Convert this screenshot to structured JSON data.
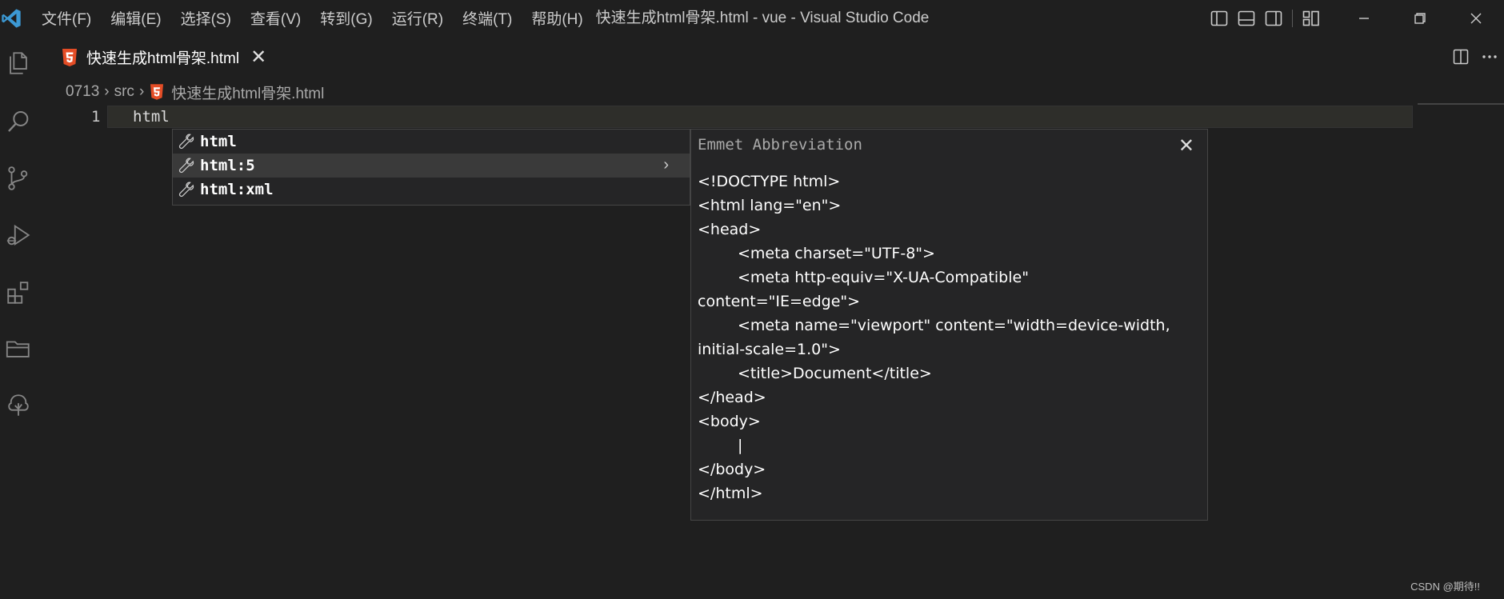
{
  "titlebar": {
    "menu": [
      "文件(F)",
      "编辑(E)",
      "选择(S)",
      "查看(V)",
      "转到(G)",
      "运行(R)",
      "终端(T)",
      "帮助(H)"
    ],
    "title": "快速生成html骨架.html - vue - Visual Studio Code"
  },
  "tab": {
    "label": "快速生成html骨架.html",
    "close": "✕"
  },
  "breadcrumb": {
    "items": [
      "0713",
      "src",
      "快速生成html骨架.html"
    ],
    "separator": "›"
  },
  "editor": {
    "line_number": "1",
    "code": "html"
  },
  "suggest": {
    "items": [
      {
        "label": "html"
      },
      {
        "label": "html:5"
      },
      {
        "label": "html:xml"
      }
    ],
    "chevron": "›"
  },
  "details": {
    "title": "Emmet Abbreviation",
    "close": "✕",
    "lines": [
      "<!DOCTYPE html>",
      "<html lang=\"en\">",
      "<head>",
      "<meta charset=\"UTF-8\">",
      "<meta http-equiv=\"X-UA-Compatible\"",
      "content=\"IE=edge\">",
      "<meta name=\"viewport\" content=\"width=device-width,",
      "initial-scale=1.0\">",
      "<title>Document</title>",
      "</head>",
      "<body>",
      "|",
      "</body>",
      "</html>"
    ]
  },
  "watermark": "CSDN @期待!!",
  "colors": {
    "background": "#1f1f1f",
    "vscode_blue": "#3c99d4",
    "html5_orange": "#e44d26"
  },
  "icons": {
    "activity": [
      "explorer-icon",
      "search-icon",
      "source-control-icon",
      "run-debug-icon",
      "extensions-icon",
      "folder-icon",
      "tree-icon"
    ]
  }
}
